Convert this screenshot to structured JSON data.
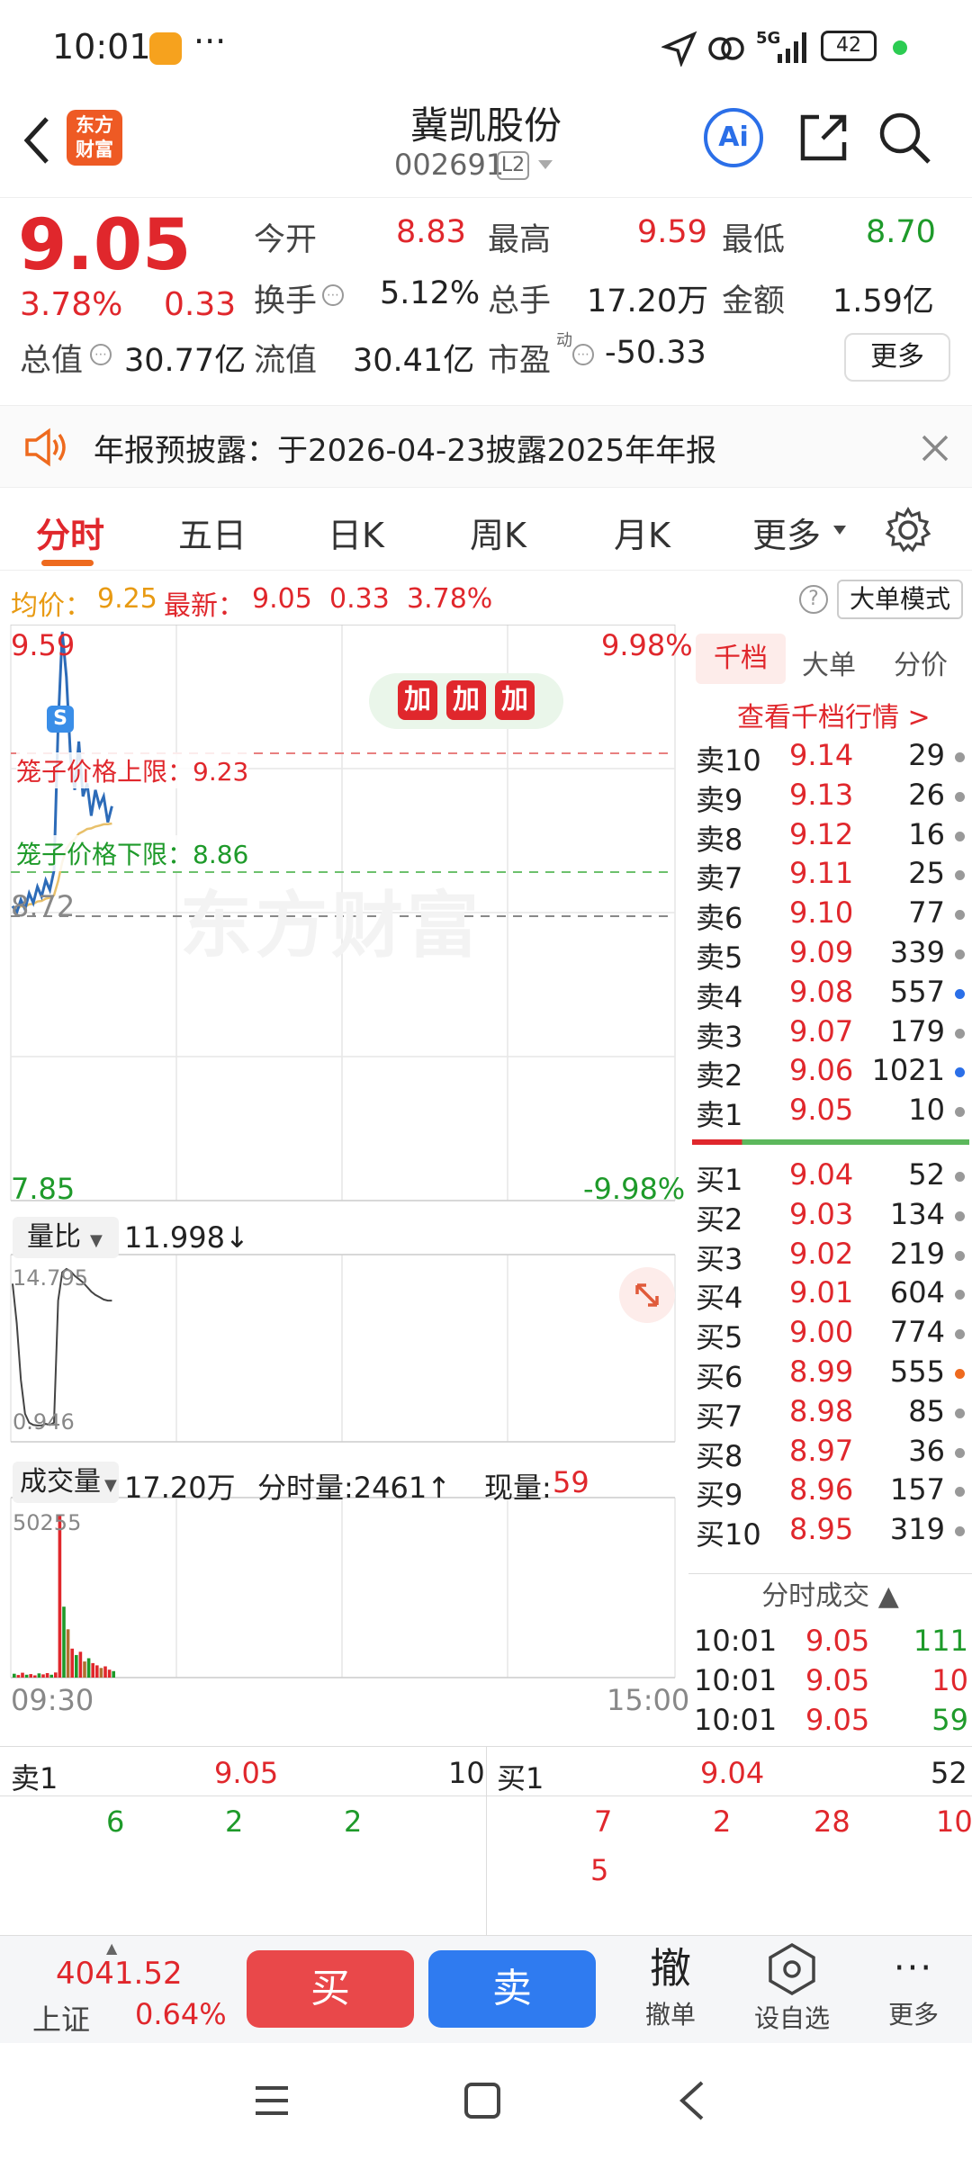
{
  "status": {
    "time": "10:01",
    "dots": "···",
    "net": "5G",
    "battery": "42"
  },
  "nav": {
    "logo": "东方财富",
    "title": "冀凯股份",
    "code": "002691",
    "level": "L2",
    "ai": "Ai"
  },
  "quote": {
    "price": "9.05",
    "pct": "3.78%",
    "chg": "0.33",
    "open_label": "今开",
    "open": "8.83",
    "high_label": "最高",
    "high": "9.59",
    "low_label": "最低",
    "low": "8.70",
    "turn_label": "换手",
    "turn": "5.12%",
    "vol_label": "总手",
    "vol": "17.20万",
    "amt_label": "金额",
    "amt": "1.59亿",
    "mcap_label": "总值",
    "mcap": "30.77亿",
    "fmcap_label": "流值",
    "fmcap": "30.41亿",
    "pe_label": "市盈",
    "pe_sup": "动",
    "pe": "-50.33",
    "more": "更多"
  },
  "notice": {
    "text": "年报预披露：于2026-04-23披露2025年年报"
  },
  "tabs": [
    "分时",
    "五日",
    "日K",
    "周K",
    "月K",
    "更多"
  ],
  "avg": {
    "avg_label": "均价：",
    "avg": "9.25",
    "last_label": "最新：",
    "last": "9.05",
    "chg": "0.33",
    "pct": "3.78%",
    "mode": "大单模式"
  },
  "chart": {
    "top_price": "9.59",
    "top_pct": "9.98%",
    "bottom_price": "7.85",
    "bottom_pct": "-9.98%",
    "base": "8.72",
    "upper_limit": "笼子价格上限：9.23",
    "lower_limit": "笼子价格下限：8.86",
    "watermark": "东方财富",
    "badge": "S",
    "add_label": "加",
    "vr_label": "量比",
    "vr_value": "11.998↓",
    "vr_max": "14.795",
    "vr_min": "0.946",
    "vol_label": "成交量",
    "vol_total": "17.20万",
    "vol_min_label": "分时量:2461↑",
    "vol_now_label": "现量:",
    "vol_now": "59",
    "vol_max": "50255",
    "time_start": "09:30",
    "time_end": "15:00",
    "price_line": [
      8.74,
      8.72,
      8.76,
      8.73,
      8.78,
      8.75,
      8.8,
      8.77,
      8.82,
      8.79,
      8.85,
      9.3,
      9.59,
      9.45,
      9.2,
      9.1,
      9.25,
      9.08,
      9.12,
      9.02,
      9.1,
      9.05,
      9.08,
      9.0,
      9.05
    ],
    "volume_bars": [
      1200,
      800,
      1500,
      900,
      1100,
      700,
      1300,
      1000,
      1400,
      900,
      1600,
      50255,
      22000,
      15000,
      9000,
      7000,
      8000,
      5000,
      6000,
      4500,
      3800,
      3000,
      3500,
      2461,
      2000
    ]
  },
  "book": {
    "tabs": [
      "千档",
      "大单",
      "分价"
    ],
    "link": "查看千档行情 >",
    "asks": [
      [
        "卖10",
        "9.14",
        "29"
      ],
      [
        "卖9",
        "9.13",
        "26"
      ],
      [
        "卖8",
        "9.12",
        "16"
      ],
      [
        "卖7",
        "9.11",
        "25"
      ],
      [
        "卖6",
        "9.10",
        "77"
      ],
      [
        "卖5",
        "9.09",
        "339"
      ],
      [
        "卖4",
        "9.08",
        "557"
      ],
      [
        "卖3",
        "9.07",
        "179"
      ],
      [
        "卖2",
        "9.06",
        "1021"
      ],
      [
        "卖1",
        "9.05",
        "10"
      ]
    ],
    "bids": [
      [
        "买1",
        "9.04",
        "52"
      ],
      [
        "买2",
        "9.03",
        "134"
      ],
      [
        "买3",
        "9.02",
        "219"
      ],
      [
        "买4",
        "9.01",
        "604"
      ],
      [
        "买5",
        "9.00",
        "774"
      ],
      [
        "买6",
        "8.99",
        "555"
      ],
      [
        "买7",
        "8.98",
        "85"
      ],
      [
        "买8",
        "8.97",
        "36"
      ],
      [
        "买9",
        "8.96",
        "157"
      ],
      [
        "买10",
        "8.95",
        "319"
      ]
    ],
    "trades_title": "分时成交",
    "trades": [
      [
        "10:01",
        "9.05",
        "111"
      ],
      [
        "10:01",
        "9.05",
        "10"
      ],
      [
        "10:01",
        "9.05",
        "59"
      ]
    ]
  },
  "queue": {
    "sell_label": "卖1",
    "sell_price": "9.05",
    "sell_vol": "10",
    "buy_label": "买1",
    "buy_price": "9.04",
    "buy_vol": "52",
    "sell_items": [
      "6",
      "2",
      "2"
    ],
    "buy_items": [
      "7",
      "2",
      "28",
      "10",
      "5"
    ]
  },
  "bottom": {
    "index_value": "4041.52",
    "index_name": "上证",
    "index_pct": "0.64%",
    "buy": "买",
    "sell": "卖",
    "cancel_big": "撤",
    "cancel": "撤单",
    "watch": "设自选",
    "more": "更多"
  }
}
